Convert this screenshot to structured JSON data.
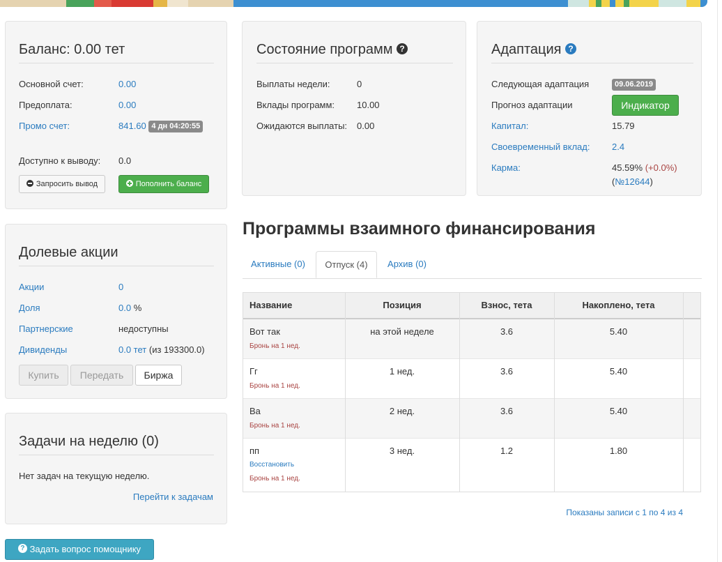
{
  "balance": {
    "title": "Баланс: 0.00 тет",
    "main_label": "Основной счет:",
    "main_value": "0.00",
    "prepay_label": "Предоплата:",
    "prepay_value": "0.00",
    "promo_label": "Промо счет:",
    "promo_value": "841.60",
    "promo_badge": "4 дн 04:20:55",
    "available_label": "Доступно к выводу:",
    "available_value": "0.0",
    "withdraw_button": "Запросить вывод",
    "topup_button": "Пополнить баланс"
  },
  "shares": {
    "title": "Долевые акции",
    "shares_label": "Акции",
    "shares_value": "0",
    "share_label": "Доля",
    "share_value": "0.0",
    "share_unit": "%",
    "partner_label": "Партнерские",
    "partner_value": "недоступны",
    "dividends_label": "Дивиденды",
    "dividends_value": "0.0 тет",
    "dividends_note": "(из 193300.0)",
    "buy_button": "Купить",
    "transfer_button": "Передать",
    "exchange_button": "Биржа"
  },
  "tasks": {
    "title": "Задачи на неделю (0)",
    "empty_text": "Нет задач на текущую неделю.",
    "go_link": "Перейти к задачам"
  },
  "help_button": "Задать вопрос помощнику",
  "programs_state": {
    "title": "Состояние программ",
    "week_payouts_label": "Выплаты недели:",
    "week_payouts_value": "0",
    "deposits_label": "Вклады программ:",
    "deposits_value": "10.00",
    "expected_label": "Ожидаются выплаты:",
    "expected_value": "0.00"
  },
  "adaptation": {
    "title": "Адаптация",
    "next_label": "Следующая адаптация",
    "next_value": "09.06.2019",
    "forecast_label": "Прогноз адаптации",
    "indicator_button": "Индикатор",
    "capital_label": "Капитал:",
    "capital_value": "15.79",
    "timely_label": "Своевременный вклад:",
    "timely_value": "2.4",
    "karma_label": "Карма:",
    "karma_value": "45.59%",
    "karma_delta": "(+0.0%)",
    "karma_rank": "№12644",
    "paren_open": "(",
    "paren_close": ")"
  },
  "programs": {
    "title": "Программы взаимного финансирования",
    "tabs": [
      {
        "label": "Активные (0)"
      },
      {
        "label": "Отпуск (4)"
      },
      {
        "label": "Архив (0)"
      }
    ],
    "columns": [
      "Название",
      "Позиция",
      "Взнос, тета",
      "Накоплено, тета"
    ],
    "rows": [
      {
        "name": "Вот так",
        "restore": "",
        "note": "Бронь на 1 нед.",
        "position": "на этой неделе",
        "contribution": "3.6",
        "accumulated": "5.40"
      },
      {
        "name": "Гг",
        "restore": "",
        "note": "Бронь на 1 нед.",
        "position": "1 нед.",
        "contribution": "3.6",
        "accumulated": "5.40"
      },
      {
        "name": "Ва",
        "restore": "",
        "note": "Бронь на 1 нед.",
        "position": "2 нед.",
        "contribution": "3.6",
        "accumulated": "5.40"
      },
      {
        "name": "пп",
        "restore": "Восстановить",
        "note": "Бронь на 1 нед.",
        "position": "3 нед.",
        "contribution": "1.2",
        "accumulated": "1.80"
      }
    ],
    "info": "Показаны записи с 1 по 4 из 4"
  },
  "colors": {
    "link": "#2a7bbf",
    "success": "#4cae4c",
    "panel": "#f5f5f5",
    "danger_text": "#a94442",
    "info_button": "#3ea6c2"
  },
  "icons": {
    "question": "?"
  }
}
